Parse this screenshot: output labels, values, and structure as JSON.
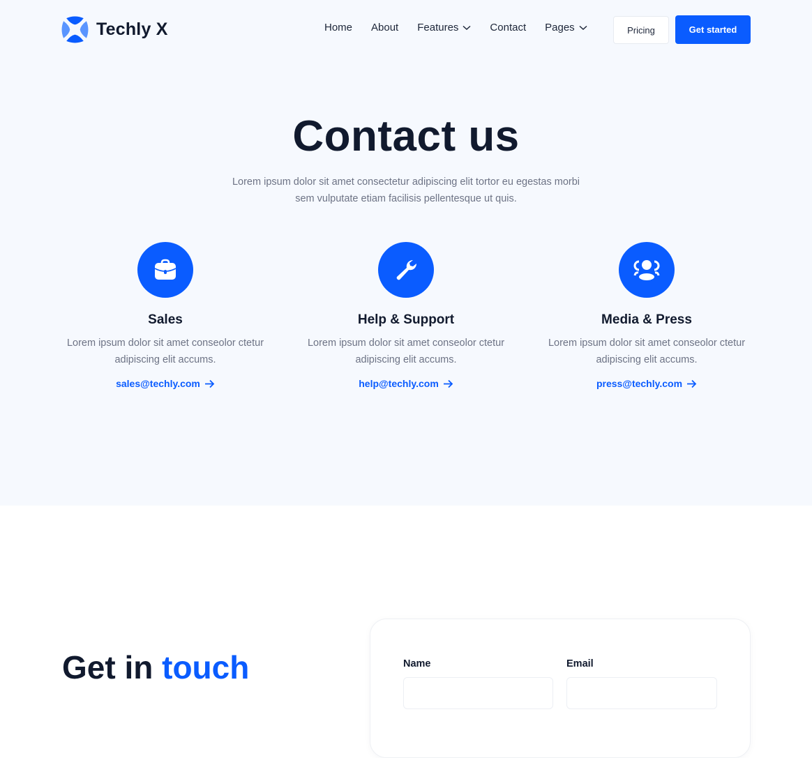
{
  "brand": {
    "name": "Techly X",
    "accent": "#0a5cff"
  },
  "nav": {
    "items": [
      {
        "label": "Home",
        "dropdown": false
      },
      {
        "label": "About",
        "dropdown": false
      },
      {
        "label": "Features",
        "dropdown": true
      },
      {
        "label": "Contact",
        "dropdown": false
      },
      {
        "label": "Pages",
        "dropdown": true
      }
    ],
    "pricing_label": "Pricing",
    "cta_label": "Get started"
  },
  "hero": {
    "title": "Contact us",
    "subtitle": "Lorem ipsum dolor sit amet consectetur adipiscing elit tortor eu egestas morbi sem vulputate etiam facilisis pellentesque ut quis."
  },
  "cards": [
    {
      "icon": "briefcase-icon",
      "title": "Sales",
      "text": "Lorem ipsum dolor sit amet conseolor ctetur adipiscing elit accums.",
      "email": "sales@techly.com"
    },
    {
      "icon": "wrench-icon",
      "title": "Help & Support",
      "text": "Lorem ipsum dolor sit amet conseolor ctetur adipiscing elit accums.",
      "email": "help@techly.com"
    },
    {
      "icon": "users-icon",
      "title": "Media & Press",
      "text": "Lorem ipsum dolor sit amet conseolor ctetur adipiscing elit accums.",
      "email": "press@techly.com"
    }
  ],
  "get_in_touch": {
    "title_part1": "Get in",
    "title_part2": "touch"
  },
  "form": {
    "fields": [
      {
        "label": "Name",
        "value": ""
      },
      {
        "label": "Email",
        "value": ""
      }
    ]
  }
}
